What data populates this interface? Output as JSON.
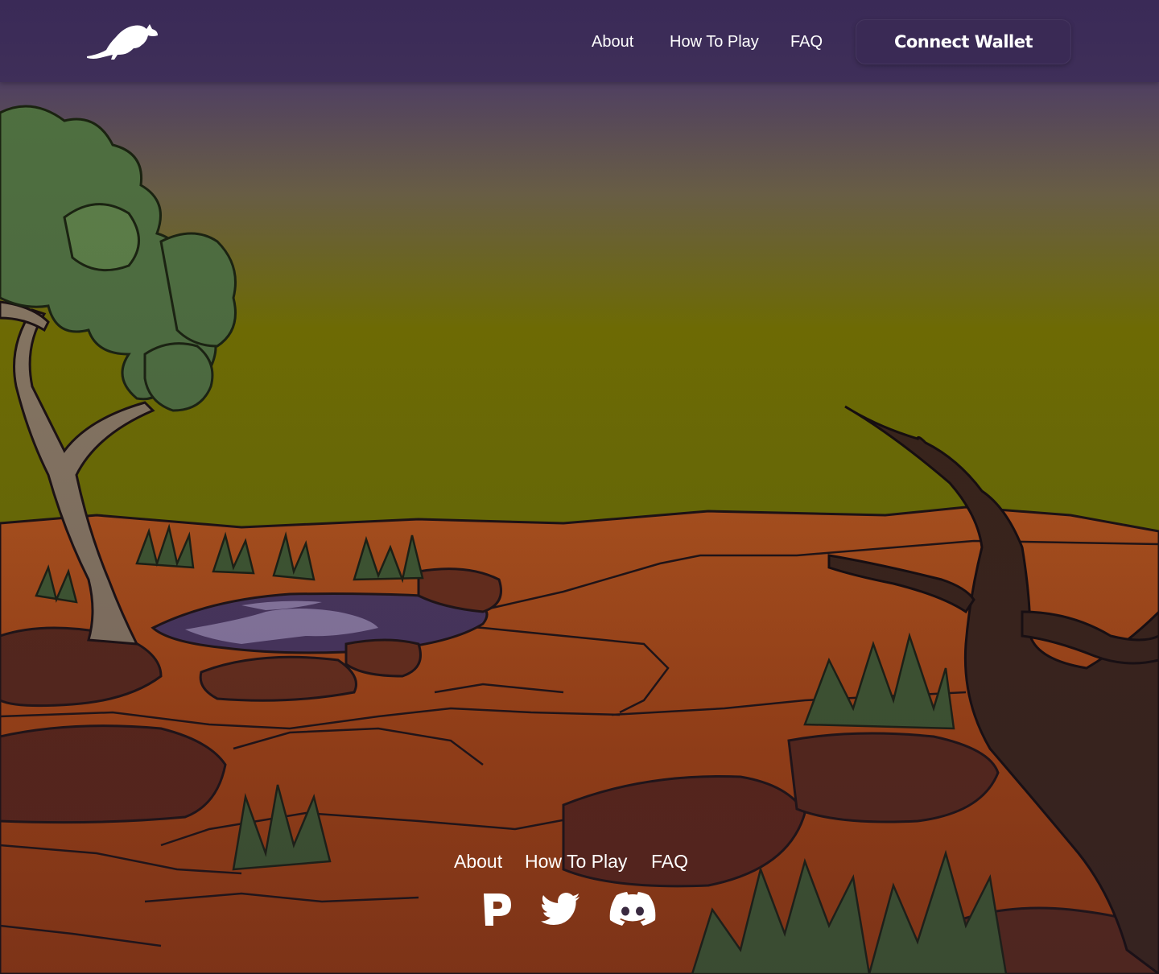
{
  "header": {
    "logo_icon": "kangaroo-icon",
    "nav": [
      {
        "label": "About"
      },
      {
        "label": "How To Play"
      },
      {
        "label": "FAQ"
      }
    ],
    "connect_wallet_label": "Connect Wallet"
  },
  "footer": {
    "links": [
      {
        "label": "About"
      },
      {
        "label": "How To Play"
      },
      {
        "label": "FAQ"
      }
    ],
    "social_icons": [
      "p-logo-icon",
      "twitter-icon",
      "discord-icon"
    ]
  },
  "colors": {
    "header_bg": "#3a2a57",
    "sky_top": "#4f3f60",
    "sky_bottom": "#6f7100",
    "ground": "#a24a10"
  }
}
